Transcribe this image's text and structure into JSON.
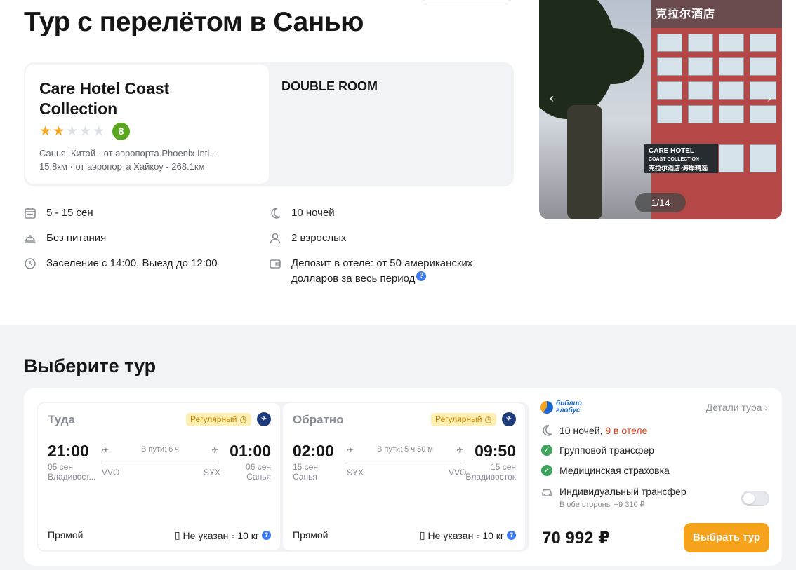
{
  "page": {
    "title": "Тур с перелётом в Санью"
  },
  "hotel": {
    "name": "Care Hotel Coast Collection",
    "stars": 2,
    "stars_max": 5,
    "rating": "8",
    "location_line1": "Санья, Китай · от аэропорта Phoenix Intl. -",
    "location_line2": "15.8км · от аэропорта Хайкоу - 268.1км",
    "room": "DOUBLE ROOM"
  },
  "info": {
    "dates": "5 - 15 сен",
    "nights": "10 ночей",
    "meals": "Без питания",
    "guests": "2 взрослых",
    "checkin": "Заселение с 14:00, Выезд до 12:00",
    "deposit": "Депозит в отеле: от 50 американских долларов за весь период",
    "deposit_help": "?"
  },
  "photo": {
    "counter": "1/14",
    "sign_cn": "克拉尔酒店",
    "sign_en": "CARE HOTEL",
    "sign_sub": "COAST COLLECTION",
    "sign_cn2": "克拉尔酒店·海岸精选"
  },
  "tours": {
    "title": "Выберите тур",
    "flights": [
      {
        "direction": "Туда",
        "badge": "Регулярный",
        "dep_time": "21:00",
        "arr_time": "01:00",
        "dep_date": "05 сен",
        "dep_city": "Владивост...",
        "arr_date": "06 сен",
        "arr_city": "Санья",
        "duration": "В пути: 6 ч",
        "dep_airport": "VVO",
        "arr_airport": "SYX",
        "type": "Прямой",
        "baggage": "Не указан",
        "hand_luggage": "10 кг"
      },
      {
        "direction": "Обратно",
        "badge": "Регулярный",
        "dep_time": "02:00",
        "arr_time": "09:50",
        "dep_date": "15 сен",
        "dep_city": "Санья",
        "arr_date": "15 сен",
        "arr_city": "Владивосток",
        "duration": "В пути: 5 ч 50 м",
        "dep_airport": "SYX",
        "arr_airport": "VVO",
        "type": "Прямой",
        "baggage": "Не указан",
        "hand_luggage": "10 кг"
      }
    ],
    "operator": {
      "line1": "библио",
      "line2": "глобус"
    },
    "details_link": "Детали тура",
    "nights_text": "10 ночей,",
    "nights_hotel": "9 в отеле",
    "feature_transfer": "Групповой трансфер",
    "feature_insurance": "Медицинская страховка",
    "individual_transfer": "Индивидуальный трансфер",
    "individual_note": "В обе стороны +9 310 ₽",
    "price": "70 992 ₽",
    "cta": "Выбрать тур"
  },
  "colors": {
    "accent": "#f7a21b",
    "rating_green": "#5aa61e",
    "star": "#f5a623",
    "highlight_red": "#e0401a"
  }
}
